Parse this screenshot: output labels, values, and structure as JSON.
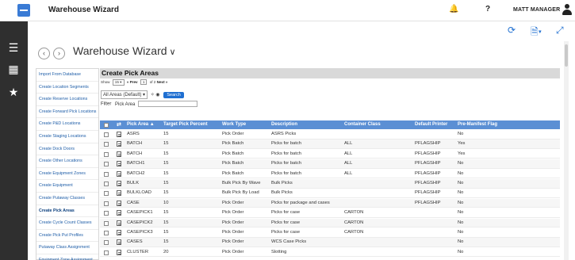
{
  "header": {
    "app_title": "Warehouse Wizard",
    "user_name": "MATT MANAGER"
  },
  "page": {
    "title": "Warehouse Wizard"
  },
  "menu": [
    "Import From Database",
    "Create Location Segments",
    "Create Reserve Locations",
    "Create Forward Pick Locations",
    "Create P&D Locations",
    "Create Staging Locations",
    "Create Dock Doors",
    "Create Other Locations",
    "Create Equipment Zones",
    "Create Equipment",
    "Create Putaway Classes",
    "Create Pick Areas",
    "Create Cycle Count Classes",
    "Create Pick Put Profiles",
    "Putaway Class Assignment",
    "Equipment Zone Assignment"
  ],
  "menu_active_index": 11,
  "content": {
    "title": "Create Pick Areas",
    "pager": {
      "show_label": "Show",
      "show_value": "15",
      "prev": "« Prev",
      "page": "1",
      "of": "of 2",
      "next": "Next »"
    },
    "area_filter": "All Areas (Default)",
    "search_label": "Search",
    "filter_label": "Filter",
    "filter_field": "Pick Area"
  },
  "table": {
    "columns": [
      "Pick Area ▲",
      "Target Pick Percent",
      "Work Type",
      "Description",
      "Container Class",
      "Default Printer",
      "Pre-Manifest Flag"
    ],
    "rows": [
      [
        "ASRS",
        "15",
        "Pick Order",
        "ASRS Picks",
        "",
        "",
        "No"
      ],
      [
        "BATCH",
        "15",
        "Pick Batch",
        "Picks for batch",
        "ALL",
        "PFLAGSHIP",
        "Yes"
      ],
      [
        "BATCH",
        "15",
        "Pick Batch",
        "Picks for batch",
        "ALL",
        "PFLAGSHIP",
        "Yes"
      ],
      [
        "BATCH1",
        "15",
        "Pick Batch",
        "Picks for batch",
        "ALL",
        "PFLAGSHIP",
        "No"
      ],
      [
        "BATCH2",
        "15",
        "Pick Batch",
        "Picks for batch",
        "ALL",
        "PFLAGSHIP",
        "No"
      ],
      [
        "BULK",
        "15",
        "Bulk Pick By Wave",
        "Bulk Picks",
        "",
        "PFLAGSHIP",
        "No"
      ],
      [
        "BULKLOAD",
        "15",
        "Bulk Pick By Load",
        "Bulk Picks",
        "",
        "PFLAGSHIP",
        "No"
      ],
      [
        "CASE",
        "10",
        "Pick Order",
        "Picks for package and cases",
        "",
        "PFLAGSHIP",
        "No"
      ],
      [
        "CASEPICK1",
        "15",
        "Pick Order",
        "Picks for case",
        "CARTON",
        "",
        "No"
      ],
      [
        "CASEPICK2",
        "15",
        "Pick Order",
        "Picks for case",
        "CARTON",
        "",
        "No"
      ],
      [
        "CASEPICK3",
        "15",
        "Pick Order",
        "Picks for case",
        "CARTON",
        "",
        "No"
      ],
      [
        "CASES",
        "15",
        "Pick Order",
        "WCS Case Picks",
        "",
        "",
        "No"
      ],
      [
        "CLUSTER",
        "20",
        "Pick Order",
        "Slotting",
        "",
        "",
        "No"
      ]
    ]
  },
  "colors": {
    "accent": "#1f6fd1",
    "table_header": "#5b8fd4",
    "sidebar": "#2f2f2f"
  },
  "icons": [
    "hamburger-icon",
    "grid-icon",
    "star-icon",
    "bell-icon",
    "help-icon",
    "user-icon",
    "refresh-icon",
    "document-icon",
    "expand-icon",
    "back-icon",
    "forward-icon"
  ]
}
